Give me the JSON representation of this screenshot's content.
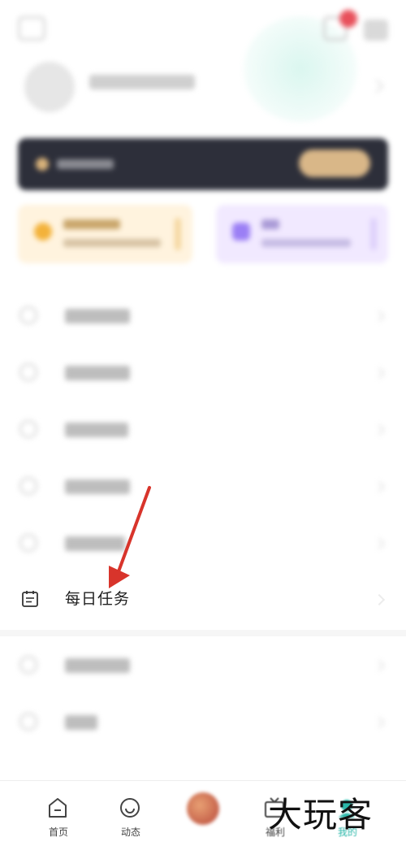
{
  "daily_task": {
    "label": "每日任务"
  },
  "bottom_nav": {
    "tabs": [
      {
        "label": "首页"
      },
      {
        "label": "动态"
      },
      {
        "label": ""
      },
      {
        "label": "福利"
      },
      {
        "label": "我的"
      }
    ]
  },
  "watermark": {
    "text": "大玩客"
  },
  "colors": {
    "vip_banner": "#2d2f3a",
    "vip_button": "#d9b788",
    "annotation_arrow": "#d8342b",
    "card_gold_bg": "#fff3de",
    "card_purple_bg": "#f1e9ff",
    "active_tab": "#2ab7a9"
  }
}
